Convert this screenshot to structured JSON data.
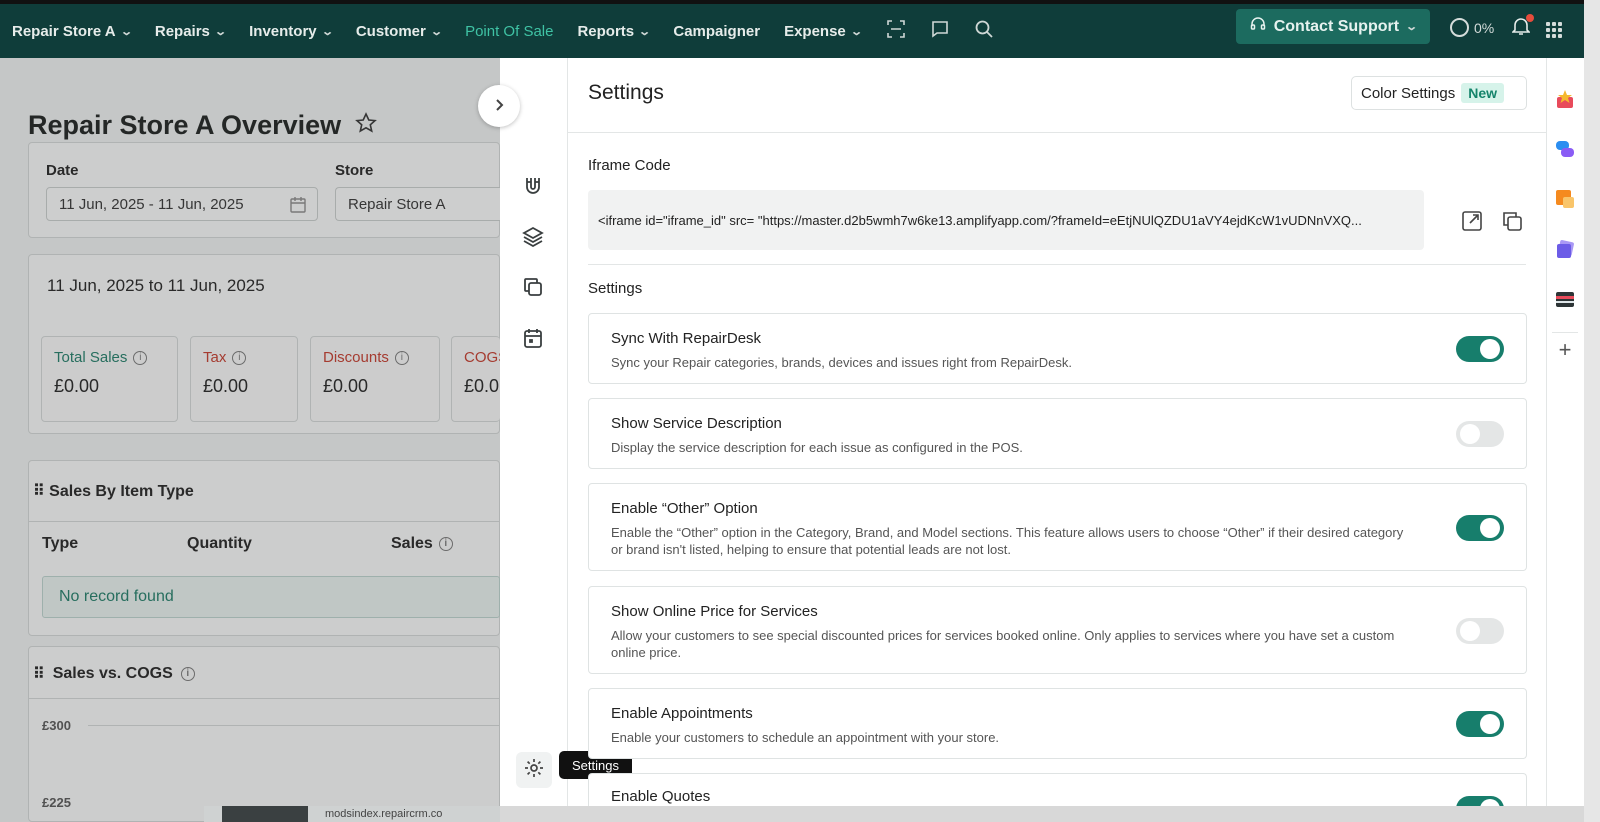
{
  "nav": {
    "store": "Repair Store A",
    "items": [
      "Repairs",
      "Inventory",
      "Customer"
    ],
    "active": "Point Of Sale",
    "reports": "Reports",
    "campaigner": "Campaigner",
    "expense": "Expense",
    "support": "Contact Support",
    "progress": "0%"
  },
  "dashboard": {
    "title": "Repair Store A Overview",
    "date_label": "Date",
    "date_value": "11 Jun, 2025 - 11 Jun, 2025",
    "store_label": "Store",
    "store_value": "Repair Store A",
    "range": "11 Jun, 2025 to 11 Jun, 2025",
    "kpis": [
      {
        "label": "Total Sales",
        "value": "£0.00",
        "color": "#1f7a66"
      },
      {
        "label": "Tax",
        "value": "£0.00",
        "color": "#c0392b"
      },
      {
        "label": "Discounts",
        "value": "£0.00",
        "color": "#c0392b"
      },
      {
        "label": "COGS",
        "value": "£0.0",
        "color": "#c0392b"
      }
    ],
    "sales_by_item_title": "Sales By Item Type",
    "col_type": "Type",
    "col_quantity": "Quantity",
    "col_sales": "Sales",
    "no_record": "No record found",
    "sales_vs_cogs_title": "Sales vs. COGS",
    "y_ticks": [
      "£300",
      "£225"
    ],
    "footer_url": "modsindex.repaircrm.co"
  },
  "panel": {
    "title": "Settings",
    "color_settings": "Color Settings",
    "new_badge": "New",
    "iframe_label": "Iframe Code",
    "iframe_code": "<iframe id=\"iframe_id\" src= \"https://master.d2b5wmh7w6ke13.amplifyapp.com/?frameId=eEtjNUlQZDU1aVY4ejdKcW1vUDNnVXQ...",
    "settings_label": "Settings",
    "tooltip": "Settings",
    "rows": [
      {
        "title": "Sync With RepairDesk",
        "desc": "Sync your Repair categories, brands, devices and issues right from RepairDesk.",
        "on": true
      },
      {
        "title": "Show Service Description",
        "desc": "Display the service description for each issue as configured in the POS.",
        "on": false
      },
      {
        "title": "Enable “Other” Option",
        "desc": "Enable the “Other” option in the Category, Brand, and Model sections. This feature allows users to choose “Other” if their desired category or brand isn't listed, helping to ensure that potential leads are not lost.",
        "on": true
      },
      {
        "title": "Show Online Price for Services",
        "desc": "Allow your customers to see special discounted prices for services booked online. Only applies to services where you have set a custom online price.",
        "on": false
      },
      {
        "title": "Enable Appointments",
        "desc": "Enable your customers to schedule an appointment with your store.",
        "on": true
      },
      {
        "title": "Enable Quotes",
        "desc": "",
        "on": true
      }
    ]
  }
}
